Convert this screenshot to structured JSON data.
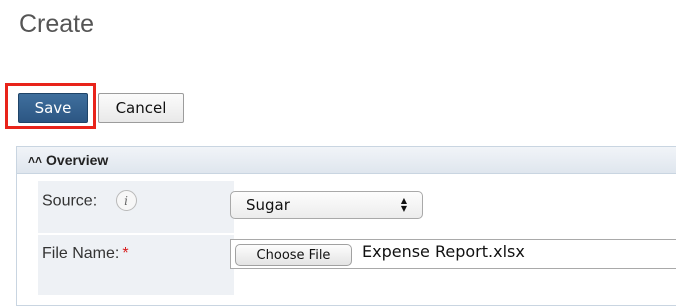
{
  "page": {
    "title": "Create"
  },
  "actions": {
    "save_label": "Save",
    "cancel_label": "Cancel"
  },
  "panel": {
    "title": "Overview",
    "icon": "double-chevron-up-icon",
    "fields": {
      "source": {
        "label": "Source:",
        "info_icon": "info-icon",
        "info_glyph": "i",
        "value": "Sugar"
      },
      "file_name": {
        "label": "File Name:",
        "required_mark": "*",
        "button_label": "Choose File",
        "value": "Expense Report.xlsx"
      }
    }
  },
  "colors": {
    "save_bg": "#2c5683",
    "highlight": "#e8231a",
    "required": "#d81b1b"
  }
}
